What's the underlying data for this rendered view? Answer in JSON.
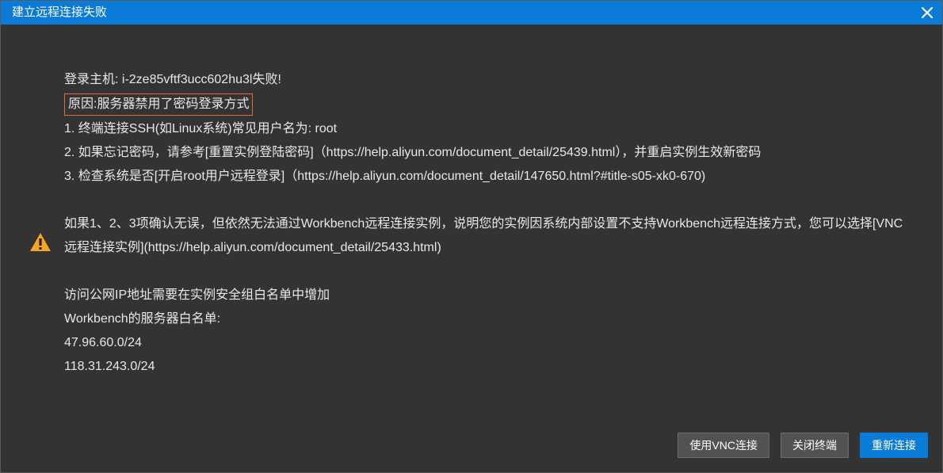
{
  "dialog": {
    "title": "建立远程连接失败"
  },
  "content": {
    "line_login_fail": "登录主机: i-2ze85vftf3ucc602hu3l失败!",
    "reason_highlight": "原因:服务器禁用了密码登录方式",
    "tip1": "1. 终端连接SSH(如Linux系统)常见用户名为: root",
    "tip2": "2. 如果忘记密码，请参考[重置实例登陆密码]（https://help.aliyun.com/document_detail/25439.html），并重启实例生效新密码",
    "tip3": "3. 检查系统是否[开启root用户远程登录]（https://help.aliyun.com/document_detail/147650.html?#title-s05-xk0-670)",
    "para2": "如果1、2、3项确认无误，但依然无法通过Workbench远程连接实例，说明您的实例因系统内部设置不支持Workbench远程连接方式，您可以选择[VNC远程连接实例](https://help.aliyun.com/document_detail/25433.html)",
    "sg_line1": "访问公网IP地址需要在实例安全组白名单中增加",
    "sg_line2": "Workbench的服务器白名单:",
    "ip1": "47.96.60.0/24",
    "ip2": "118.31.243.0/24"
  },
  "buttons": {
    "vnc": "使用VNC连接",
    "close_terminal": "关闭终端",
    "reconnect": "重新连接"
  }
}
